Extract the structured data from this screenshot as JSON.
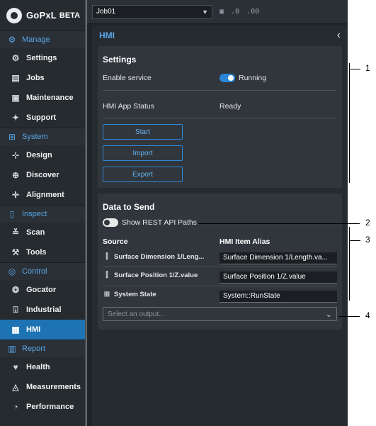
{
  "brand": {
    "name": "GoPxL",
    "badge": "BETA"
  },
  "sidebar": {
    "sections": [
      {
        "label": "Manage",
        "icon": "gears-icon",
        "items": [
          {
            "label": "Settings",
            "icon": "gear-icon"
          },
          {
            "label": "Jobs",
            "icon": "document-icon"
          },
          {
            "label": "Maintenance",
            "icon": "toolbox-icon"
          },
          {
            "label": "Support",
            "icon": "support-icon"
          }
        ]
      },
      {
        "label": "System",
        "icon": "network-icon",
        "items": [
          {
            "label": "Design",
            "icon": "design-icon"
          },
          {
            "label": "Discover",
            "icon": "discover-icon"
          },
          {
            "label": "Alignment",
            "icon": "alignment-icon"
          }
        ]
      },
      {
        "label": "Inspect",
        "icon": "inspect-icon",
        "items": [
          {
            "label": "Scan",
            "icon": "scan-icon"
          },
          {
            "label": "Tools",
            "icon": "tools-icon"
          }
        ]
      },
      {
        "label": "Control",
        "icon": "control-icon",
        "items": [
          {
            "label": "Gocator",
            "icon": "gocator-icon"
          },
          {
            "label": "Industrial",
            "icon": "industrial-icon"
          },
          {
            "label": "HMI",
            "icon": "hmi-icon",
            "active": true
          }
        ]
      },
      {
        "label": "Report",
        "icon": "report-icon",
        "items": [
          {
            "label": "Health",
            "icon": "heart-icon"
          },
          {
            "label": "Measurements",
            "icon": "measurements-icon"
          },
          {
            "label": "Performance",
            "icon": "gauge-icon"
          }
        ]
      }
    ]
  },
  "toolbar": {
    "job": "Job01",
    "save_icon": "save-icon",
    "decrease_decimals": ".0",
    "increase_decimals": ".00"
  },
  "panel": {
    "title": "HMI",
    "collapse_icon": "chevron-left-icon"
  },
  "settings": {
    "title": "Settings",
    "enable_service_label": "Enable service",
    "enable_service_state": "Running",
    "status_label": "HMI App Status",
    "status_value": "Ready",
    "buttons": [
      "Start",
      "Import",
      "Export"
    ]
  },
  "data_to_send": {
    "title": "Data to Send",
    "show_paths_label": "Show REST API Paths",
    "col_source": "Source",
    "col_alias": "HMI Item Alias",
    "rows": [
      {
        "source": "Surface Dimension 1/Leng...",
        "alias": "Surface Dimension 1/Length.va...",
        "icon": "measurement-tool-icon"
      },
      {
        "source": "Surface Position 1/Z.value",
        "alias": "Surface Position 1/Z.value",
        "icon": "measurement-tool-icon"
      },
      {
        "source": "System State",
        "alias": "System::RunState",
        "icon": "network-icon"
      }
    ],
    "output_placeholder": "Select an output..."
  },
  "callouts": [
    "1",
    "2",
    "3",
    "4"
  ],
  "colors": {
    "accent": "#1e73b4",
    "link": "#5aa8e8",
    "background": "#1f2429"
  }
}
